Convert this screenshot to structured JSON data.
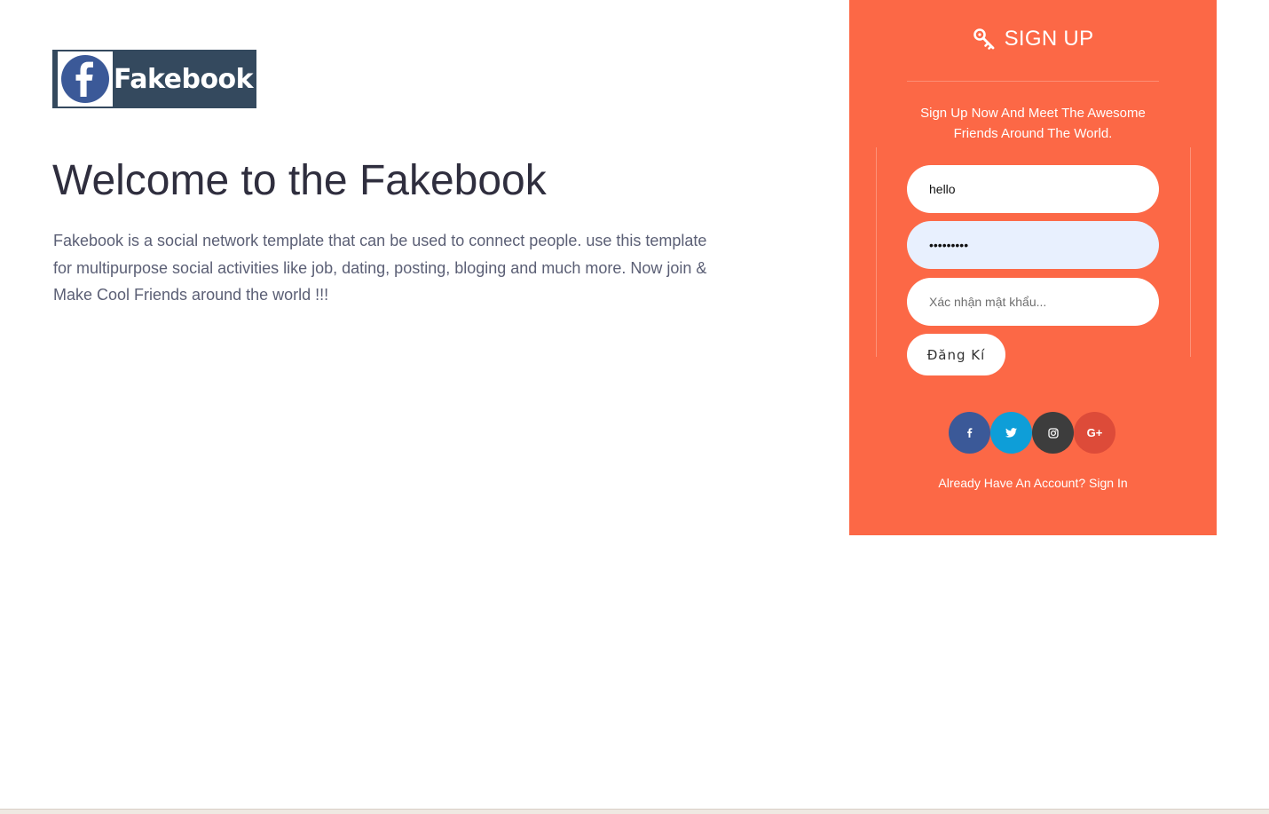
{
  "logo": {
    "text": "Fakebook",
    "icon": "facebook-f-icon"
  },
  "hero": {
    "title": "Welcome to the Fakebook",
    "description": "Fakebook is a social network template that can be used to connect people. use this template for multipurpose social activities like job, dating, posting, bloging and much more. Now join & Make Cool Friends around the world !!!"
  },
  "signup": {
    "title": "SIGN UP",
    "title_icon": "key-icon",
    "subtitle": "Sign Up Now And Meet The Awesome Friends Around The World.",
    "username_value": "hello",
    "password_mask": "•••••••••",
    "confirm_placeholder": "Xác nhận mật khẩu...",
    "submit_label": "Đăng Kí",
    "social_icons": [
      "facebook-icon",
      "twitter-icon",
      "instagram-icon",
      "google-plus-icon"
    ],
    "google_plus_label": "G+",
    "signin_text": "Already Have An Account? Sign In",
    "colors": {
      "panel": "#fc6846",
      "facebook": "#3b5998",
      "twitter": "#0e9ed8",
      "instagram": "#3d3d3d",
      "google_plus": "#dd4b39"
    }
  }
}
